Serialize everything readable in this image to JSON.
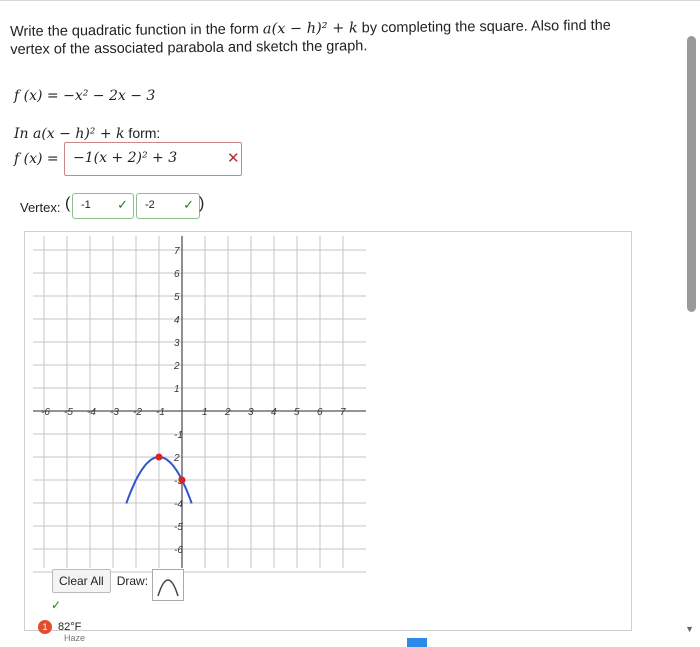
{
  "question": {
    "prefix": "Write the quadratic function in the form ",
    "form_expr": "a(x − h)² + k",
    "suffix": " by completing the square. Also find the vertex of the associated parabola and sketch the graph."
  },
  "function_expr": "f (x) = −x² − 2x − 3",
  "in_form_label": {
    "expr": "In a(x − h)² + k",
    "tail": " form:"
  },
  "fx_label": "f (x) =",
  "answer_value": "−1(x + 2)² + 3",
  "answer_status_icon": "x-icon",
  "vertex": {
    "label": "Vertex:",
    "open": "(",
    "x": "-1",
    "y": "-2",
    "close": ")",
    "check": "✓"
  },
  "graph": {
    "x_ticks": [
      "7",
      "-6",
      "-5",
      "-4",
      "-3",
      "-2",
      "-1",
      "1",
      "2",
      "3",
      "4",
      "5",
      "6",
      "7"
    ],
    "y_ticks": [
      "7",
      "6",
      "5",
      "4",
      "3",
      "2",
      "1",
      "-1",
      "2",
      "-3",
      "-4",
      "-5",
      "-6",
      "-7"
    ],
    "curve_color": "#3355cc",
    "point_color": "#dd2222"
  },
  "toolbar": {
    "clear_label": "Clear All",
    "draw_label": "Draw:"
  },
  "bottom_check": "✓",
  "weather": {
    "badge": "1",
    "temp": "82°F",
    "cond": "Haze"
  }
}
